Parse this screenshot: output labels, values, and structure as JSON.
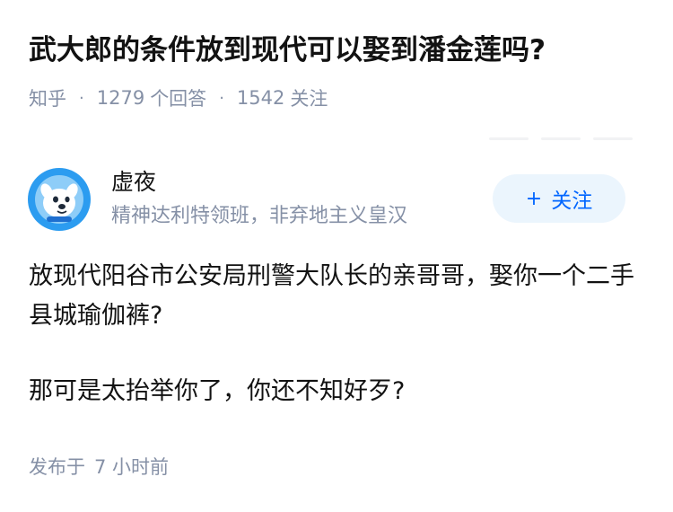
{
  "question": {
    "title": "武大郎的条件放到现代可以娶到潘金莲吗?",
    "source": "知乎",
    "answer_count": "1279",
    "answer_label": "个回答",
    "follow_count": "1542",
    "follow_label": "关注",
    "separator": "·"
  },
  "author": {
    "name": "虚夜",
    "bio": "精神达利特领班，非弃地主义皇汉",
    "avatar_icon": "cartoon-dog-avatar",
    "follow_button_plus": "+",
    "follow_button_label": "关注"
  },
  "answer": {
    "paragraphs": [
      "放现代阳谷市公安局刑警大队长的亲哥哥，娶你一个二手县城瑜伽裤?",
      "那可是太抬举你了，你还不知好歹?"
    ],
    "published_prefix": "发布于",
    "published_value": "7 小时前"
  },
  "colors": {
    "text": "#121212",
    "muted": "#8590a6",
    "accent": "#0066ff",
    "button_bg": "#ebf5fd",
    "avatar_blue": "#2c9cf0"
  }
}
